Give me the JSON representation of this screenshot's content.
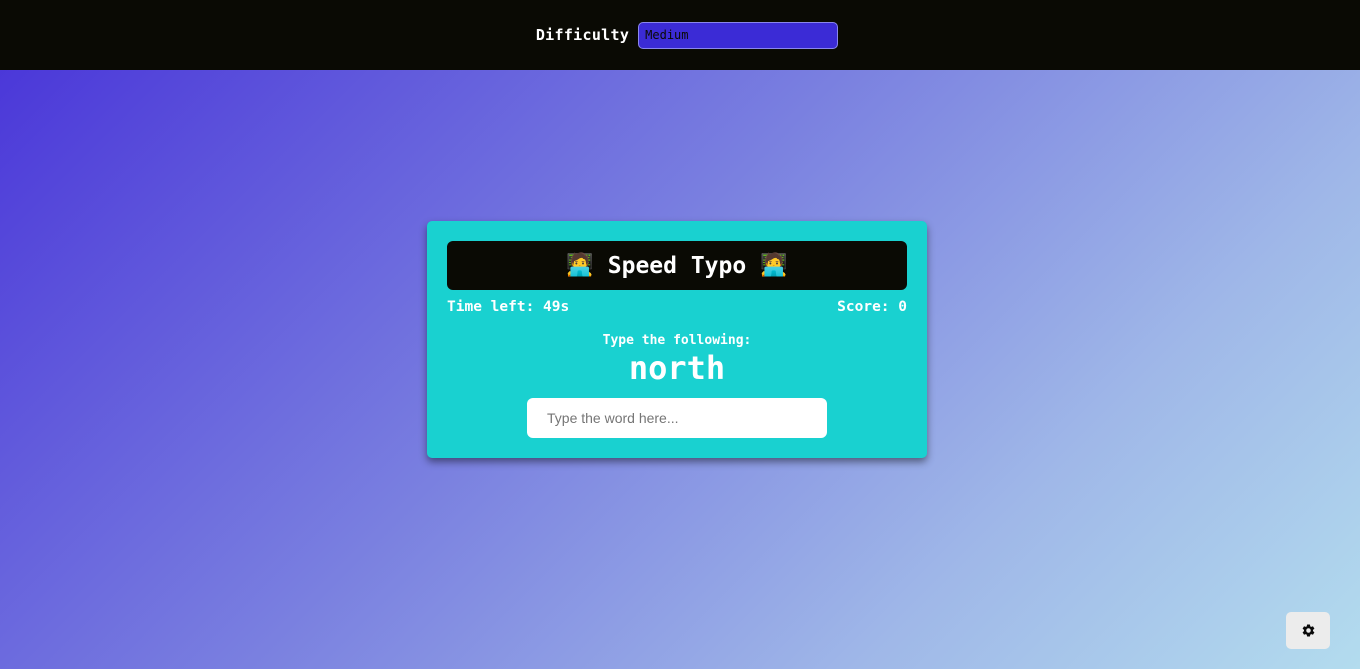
{
  "header": {
    "difficulty_label": "Difficulty",
    "difficulty_selected": "Medium"
  },
  "game": {
    "title": "Speed Typo",
    "title_emoji": "🧑‍💻",
    "time_left_text": "Time left: 49s",
    "score_text": "Score: 0",
    "prompt_text": "Type the following:",
    "current_word": "north",
    "input_placeholder": "Type the word here...",
    "input_value": ""
  },
  "settings": {
    "icon": "gear-icon"
  },
  "colors": {
    "topbar": "#0a0a04",
    "select_bg": "#3b2bd6",
    "card_bg": "#19d1d0",
    "gradient_start": "#4732d8",
    "gradient_end": "#b3dcee"
  }
}
